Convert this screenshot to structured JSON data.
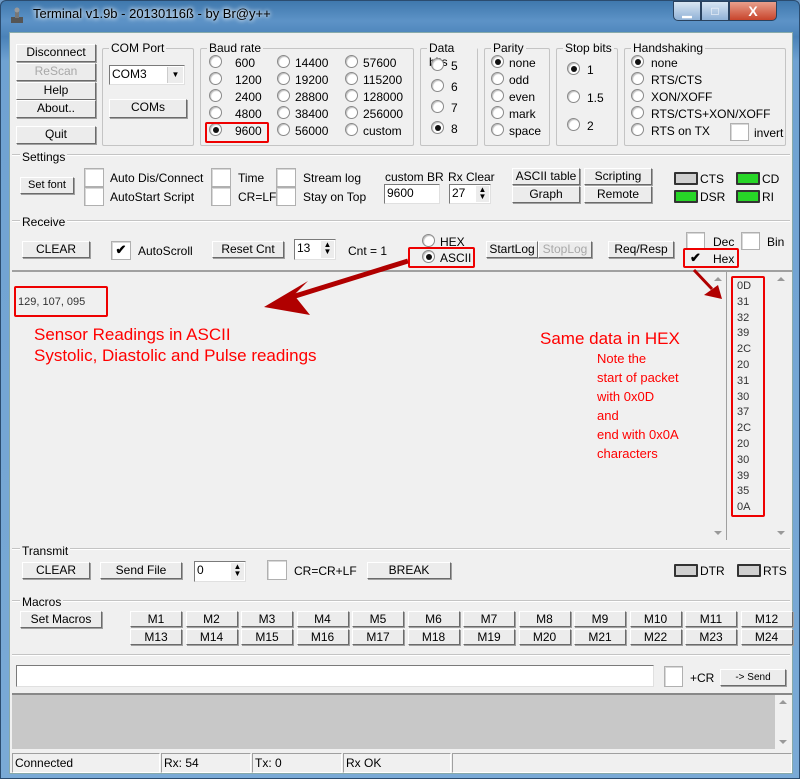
{
  "window": {
    "title": "Terminal v1.9b - 20130116ß - by Br@y++",
    "minimize_glyph": "▁",
    "maximize_glyph": "□",
    "close_glyph": "X"
  },
  "connection": {
    "disconnect": "Disconnect",
    "rescan": "ReScan",
    "help": "Help",
    "about": "About..",
    "quit": "Quit"
  },
  "com_port": {
    "legend": "COM Port",
    "selected": "COM3",
    "coms_button": "COMs"
  },
  "baud_rate": {
    "legend": "Baud rate",
    "options": [
      "600",
      "1200",
      "2400",
      "4800",
      "9600",
      "14400",
      "19200",
      "28800",
      "38400",
      "56000",
      "57600",
      "115200",
      "128000",
      "256000",
      "custom"
    ],
    "selected": "9600"
  },
  "data_bits": {
    "legend": "Data bits",
    "options": [
      "5",
      "6",
      "7",
      "8"
    ],
    "selected": "8"
  },
  "parity": {
    "legend": "Parity",
    "options": [
      "none",
      "odd",
      "even",
      "mark",
      "space"
    ],
    "selected": "none"
  },
  "stop_bits": {
    "legend": "Stop bits",
    "options": [
      "1",
      "1.5",
      "2"
    ],
    "selected": "1"
  },
  "handshaking": {
    "legend": "Handshaking",
    "options": [
      "none",
      "RTS/CTS",
      "XON/XOFF",
      "RTS/CTS+XON/XOFF",
      "RTS on TX"
    ],
    "selected": "none",
    "invert_label": "invert"
  },
  "settings": {
    "legend": "Settings",
    "set_font": "Set font",
    "auto_dis_connect": "Auto Dis/Connect",
    "autostart_script": "AutoStart Script",
    "time": "Time",
    "cr_lf": "CR=LF",
    "stream_log": "Stream log",
    "stay_on_top": "Stay on Top",
    "custom_br_label": "custom BR",
    "custom_br_value": "9600",
    "rx_clear_label": "Rx Clear",
    "rx_clear_value": "27",
    "ascii_table": "ASCII table",
    "scripting": "Scripting",
    "graph": "Graph",
    "remote": "Remote",
    "leds": {
      "cts": "CTS",
      "cd": "CD",
      "dsr": "DSR",
      "ri": "RI"
    }
  },
  "receive": {
    "legend": "Receive",
    "clear": "CLEAR",
    "autoscroll": "AutoScroll",
    "autoscroll_checked": true,
    "reset_cnt": "Reset Cnt",
    "cnt_spin": "13",
    "cnt_label": "Cnt = 1",
    "hex": "HEX",
    "ascii": "ASCII",
    "mode_selected": "ASCII",
    "start_log": "StartLog",
    "stop_log": "StopLog",
    "req_resp": "Req/Resp",
    "dec": "Dec",
    "bin": "Bin",
    "hex_check": "Hex",
    "hex_checked": true,
    "ascii_data": "129, 107, 095",
    "hex_data": [
      "0D",
      "31",
      "32",
      "39",
      "2C",
      "20",
      "31",
      "30",
      "37",
      "2C",
      "20",
      "30",
      "39",
      "35",
      "0A"
    ]
  },
  "annotations": {
    "ascii_title": "Sensor Readings in ASCII",
    "ascii_sub": "Systolic, Diastolic and Pulse readings",
    "hex_title": "Same data in HEX",
    "hex_note": [
      "Note the",
      "start of packet",
      "with 0x0D",
      "and",
      "end with 0x0A",
      "characters"
    ],
    "color": "#ff0000",
    "arrow_color": "#b00000"
  },
  "transmit": {
    "legend": "Transmit",
    "clear": "CLEAR",
    "send_file": "Send File",
    "spin_value": "0",
    "cr_crlf": "CR=CR+LF",
    "break": "BREAK",
    "dtr": "DTR",
    "rts": "RTS"
  },
  "macros": {
    "legend": "Macros",
    "set_macros": "Set Macros",
    "row1": [
      "M1",
      "M2",
      "M3",
      "M4",
      "M5",
      "M6",
      "M7",
      "M8",
      "M9",
      "M10",
      "M11",
      "M12"
    ],
    "row2": [
      "M13",
      "M14",
      "M15",
      "M16",
      "M17",
      "M18",
      "M19",
      "M20",
      "M21",
      "M22",
      "M23",
      "M24"
    ]
  },
  "send_bar": {
    "input_value": "",
    "plus_cr": "+CR",
    "send": "-> Send"
  },
  "status": {
    "connection": "Connected",
    "rx": "Rx: 54",
    "tx": "Tx: 0",
    "rx_state": "Rx OK"
  }
}
